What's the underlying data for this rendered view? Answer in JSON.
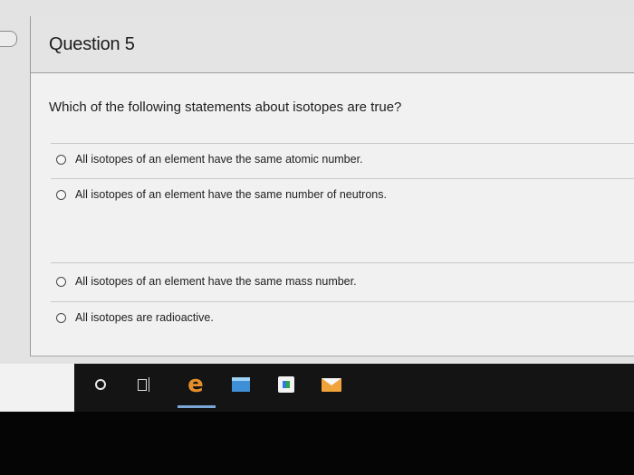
{
  "question": {
    "title": "Question 5",
    "text": "Which of the following statements about isotopes are true?",
    "options": [
      {
        "label": "All isotopes of an element have the same atomic number."
      },
      {
        "label": "All isotopes of an element have the same number of neutrons."
      },
      {
        "label": "All isotopes of an element have the same mass number."
      },
      {
        "label": "All isotopes are radioactive."
      }
    ]
  },
  "taskbar": {
    "icons": [
      "cortana-circle-icon",
      "task-view-icon",
      "edge-browser-icon",
      "file-explorer-icon",
      "store-icon",
      "mail-icon"
    ],
    "edge_glyph": "e"
  },
  "colors": {
    "taskbar": "#141414",
    "edge": "#e48f2b",
    "folder": "#3f8fd6",
    "mail": "#f0a23b"
  }
}
